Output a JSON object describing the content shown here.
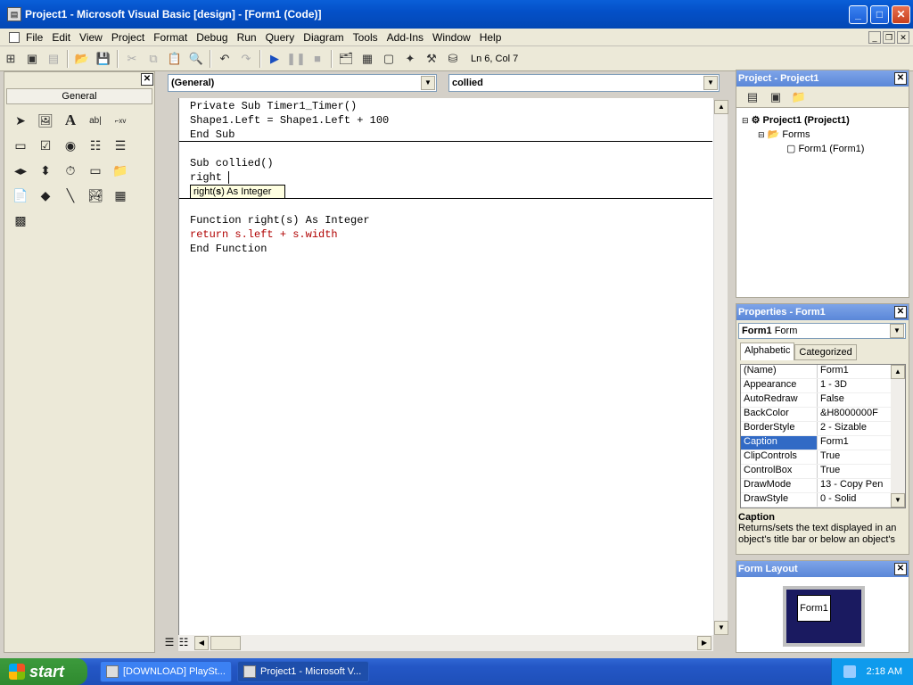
{
  "window": {
    "title": "Project1 - Microsoft Visual Basic [design] - [Form1 (Code)]"
  },
  "menu": [
    "File",
    "Edit",
    "View",
    "Project",
    "Format",
    "Debug",
    "Run",
    "Query",
    "Diagram",
    "Tools",
    "Add-Ins",
    "Window",
    "Help"
  ],
  "toolbar": {
    "position": "Ln 6, Col 7"
  },
  "toolbox": {
    "tab": "General"
  },
  "code": {
    "object_combo": "(General)",
    "proc_combo": "collied",
    "lines": [
      "Private Sub Timer1_Timer()",
      "Shape1.Left = Shape1.Left + 100",
      "End Sub",
      "Sub collied()",
      "right ",
      "Function right(s) As Integer",
      "return s.left + s.width",
      "End Function"
    ],
    "tooltip_before": "right(",
    "tooltip_bold": "s",
    "tooltip_after": ") As Integer"
  },
  "project": {
    "title": "Project - Project1",
    "root": "Project1 (Project1)",
    "folder": "Forms",
    "item": "Form1 (Form1)"
  },
  "properties": {
    "title": "Properties - Form1",
    "object_name": "Form1",
    "object_type": "Form",
    "tabs": [
      "Alphabetic",
      "Categorized"
    ],
    "rows": [
      {
        "name": "(Name)",
        "value": "Form1"
      },
      {
        "name": "Appearance",
        "value": "1 - 3D"
      },
      {
        "name": "AutoRedraw",
        "value": "False"
      },
      {
        "name": "BackColor",
        "value": "&H8000000F"
      },
      {
        "name": "BorderStyle",
        "value": "2 - Sizable"
      },
      {
        "name": "Caption",
        "value": "Form1"
      },
      {
        "name": "ClipControls",
        "value": "True"
      },
      {
        "name": "ControlBox",
        "value": "True"
      },
      {
        "name": "DrawMode",
        "value": "13 - Copy Pen"
      },
      {
        "name": "DrawStyle",
        "value": "0 - Solid"
      }
    ],
    "desc_title": "Caption",
    "desc_text": "Returns/sets the text displayed in an object's title bar or below an object's"
  },
  "formlayout": {
    "title": "Form Layout",
    "form_label": "Form1"
  },
  "taskbar": {
    "start": "start",
    "tasks": [
      "[DOWNLOAD] PlaySt...",
      "Project1 - Microsoft V..."
    ],
    "clock": "2:18 AM"
  },
  "colors": {
    "keyword": "#000000",
    "error": "#b00000",
    "selection": "#316ac5"
  }
}
